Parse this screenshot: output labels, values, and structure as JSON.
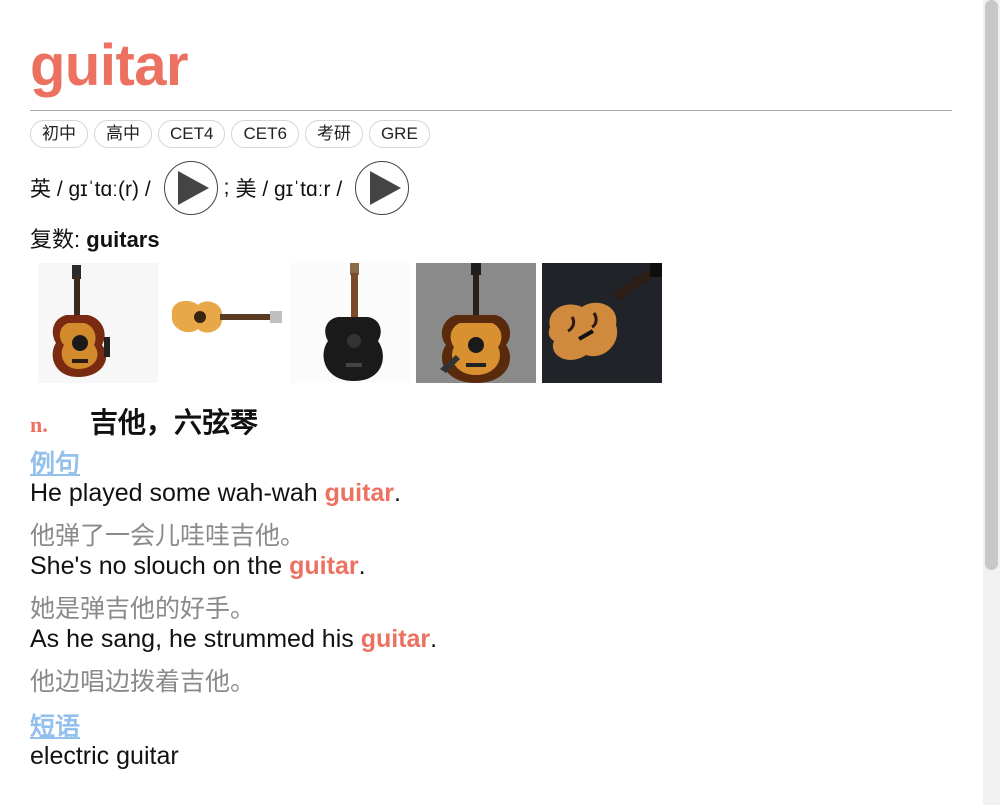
{
  "word": "guitar",
  "tags": [
    "初中",
    "高中",
    "CET4",
    "CET6",
    "考研",
    "GRE"
  ],
  "pronunciation": {
    "uk": "英 / ɡɪˈtɑː(r) /",
    "separator": ";",
    "us": "美 / ɡɪˈtɑːr /"
  },
  "plural": {
    "label": "复数:",
    "value": "guitars"
  },
  "images": [
    "guitar-photo-1",
    "guitar-photo-2",
    "guitar-photo-3",
    "guitar-photo-4",
    "guitar-photo-5"
  ],
  "definition": {
    "pos": "n.",
    "meaning": "吉他，六弦琴"
  },
  "examples_title": "例句",
  "examples": [
    {
      "before": "He played some wah-wah ",
      "highlight": "guitar",
      "after": ".",
      "zh": "他弹了一会儿哇哇吉他。"
    },
    {
      "before": "She's no slouch on the ",
      "highlight": "guitar",
      "after": ".",
      "zh": "她是弹吉他的好手。"
    },
    {
      "before": "As he sang, he strummed his ",
      "highlight": "guitar",
      "after": ".",
      "zh": "他边唱边拨着吉他。"
    }
  ],
  "phrases_title": "短语",
  "phrases": [
    {
      "en": "electric guitar"
    }
  ],
  "colors": {
    "accent": "#ec7160",
    "link": "#93c0ec",
    "translation": "#8a8a8a"
  }
}
